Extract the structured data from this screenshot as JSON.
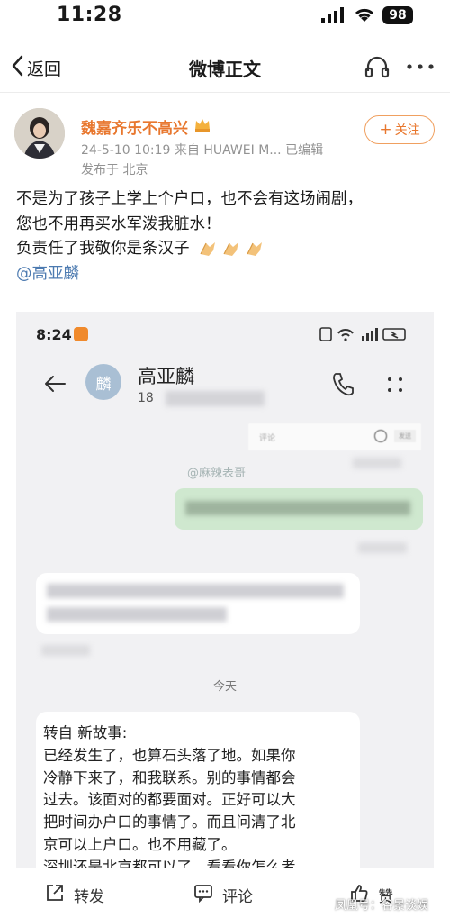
{
  "status_bar": {
    "time": "11:28",
    "battery": "98"
  },
  "nav": {
    "back_label": "返回",
    "title": "微博正文"
  },
  "author": {
    "name": "魏嘉齐乐不高兴",
    "meta_line": "24-5-10 10:19  来自 HUAWEI M...  已编辑",
    "location": "发布于 北京",
    "follow_label": "关注"
  },
  "post": {
    "lines": [
      "不是为了孩子上学上个户口，也不会有这场闹剧，",
      "您也不用再买水军泼我脏水！",
      "负责任了我敬你是条汉子"
    ],
    "mention": "@高亚麟"
  },
  "screenshot": {
    "time": "8:24",
    "contact_name": "高亚麟",
    "phone_prefix": "18",
    "avatar_char": "麟",
    "comment_placeholder": "评论",
    "send_label": "发送",
    "watermark": "@麻辣表哥",
    "time_divider": "今天",
    "message_lines": [
      "转自 新故事:",
      "已经发生了，也算石头落了地。如果你",
      "冷静下来了，和我联系。别的事情都会",
      "过去。该面对的都要面对。正好可以大",
      "把时间办户口的事情了。而且问清了北",
      "京可以上户口。也不用藏了。",
      "深圳还是北京都可以了。看看你怎么考"
    ]
  },
  "toolbar": {
    "repost_label": "转发",
    "comment_label": "评论",
    "like_label": "赞"
  },
  "footer_watermark": "凤凰号：谷景谈娱",
  "colors": {
    "accent_orange": "#e8772e",
    "mention_blue": "#4c7ab0"
  }
}
